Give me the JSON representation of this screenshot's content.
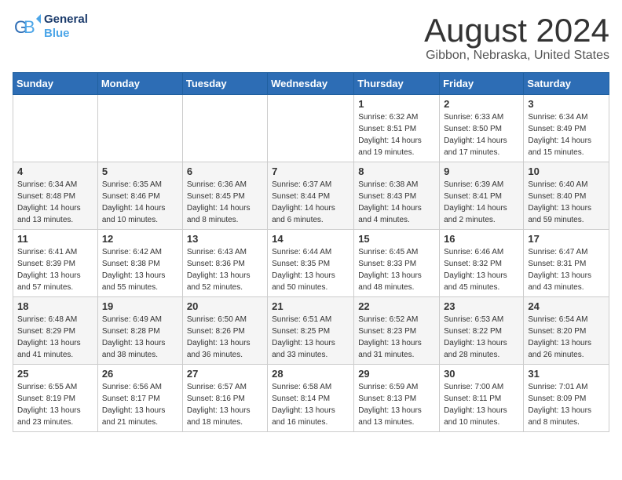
{
  "header": {
    "logo_line1": "General",
    "logo_line2": "Blue",
    "month_title": "August 2024",
    "location": "Gibbon, Nebraska, United States"
  },
  "weekdays": [
    "Sunday",
    "Monday",
    "Tuesday",
    "Wednesday",
    "Thursday",
    "Friday",
    "Saturday"
  ],
  "weeks": [
    [
      {
        "day": "",
        "info": ""
      },
      {
        "day": "",
        "info": ""
      },
      {
        "day": "",
        "info": ""
      },
      {
        "day": "",
        "info": ""
      },
      {
        "day": "1",
        "info": "Sunrise: 6:32 AM\nSunset: 8:51 PM\nDaylight: 14 hours\nand 19 minutes."
      },
      {
        "day": "2",
        "info": "Sunrise: 6:33 AM\nSunset: 8:50 PM\nDaylight: 14 hours\nand 17 minutes."
      },
      {
        "day": "3",
        "info": "Sunrise: 6:34 AM\nSunset: 8:49 PM\nDaylight: 14 hours\nand 15 minutes."
      }
    ],
    [
      {
        "day": "4",
        "info": "Sunrise: 6:34 AM\nSunset: 8:48 PM\nDaylight: 14 hours\nand 13 minutes."
      },
      {
        "day": "5",
        "info": "Sunrise: 6:35 AM\nSunset: 8:46 PM\nDaylight: 14 hours\nand 10 minutes."
      },
      {
        "day": "6",
        "info": "Sunrise: 6:36 AM\nSunset: 8:45 PM\nDaylight: 14 hours\nand 8 minutes."
      },
      {
        "day": "7",
        "info": "Sunrise: 6:37 AM\nSunset: 8:44 PM\nDaylight: 14 hours\nand 6 minutes."
      },
      {
        "day": "8",
        "info": "Sunrise: 6:38 AM\nSunset: 8:43 PM\nDaylight: 14 hours\nand 4 minutes."
      },
      {
        "day": "9",
        "info": "Sunrise: 6:39 AM\nSunset: 8:41 PM\nDaylight: 14 hours\nand 2 minutes."
      },
      {
        "day": "10",
        "info": "Sunrise: 6:40 AM\nSunset: 8:40 PM\nDaylight: 13 hours\nand 59 minutes."
      }
    ],
    [
      {
        "day": "11",
        "info": "Sunrise: 6:41 AM\nSunset: 8:39 PM\nDaylight: 13 hours\nand 57 minutes."
      },
      {
        "day": "12",
        "info": "Sunrise: 6:42 AM\nSunset: 8:38 PM\nDaylight: 13 hours\nand 55 minutes."
      },
      {
        "day": "13",
        "info": "Sunrise: 6:43 AM\nSunset: 8:36 PM\nDaylight: 13 hours\nand 52 minutes."
      },
      {
        "day": "14",
        "info": "Sunrise: 6:44 AM\nSunset: 8:35 PM\nDaylight: 13 hours\nand 50 minutes."
      },
      {
        "day": "15",
        "info": "Sunrise: 6:45 AM\nSunset: 8:33 PM\nDaylight: 13 hours\nand 48 minutes."
      },
      {
        "day": "16",
        "info": "Sunrise: 6:46 AM\nSunset: 8:32 PM\nDaylight: 13 hours\nand 45 minutes."
      },
      {
        "day": "17",
        "info": "Sunrise: 6:47 AM\nSunset: 8:31 PM\nDaylight: 13 hours\nand 43 minutes."
      }
    ],
    [
      {
        "day": "18",
        "info": "Sunrise: 6:48 AM\nSunset: 8:29 PM\nDaylight: 13 hours\nand 41 minutes."
      },
      {
        "day": "19",
        "info": "Sunrise: 6:49 AM\nSunset: 8:28 PM\nDaylight: 13 hours\nand 38 minutes."
      },
      {
        "day": "20",
        "info": "Sunrise: 6:50 AM\nSunset: 8:26 PM\nDaylight: 13 hours\nand 36 minutes."
      },
      {
        "day": "21",
        "info": "Sunrise: 6:51 AM\nSunset: 8:25 PM\nDaylight: 13 hours\nand 33 minutes."
      },
      {
        "day": "22",
        "info": "Sunrise: 6:52 AM\nSunset: 8:23 PM\nDaylight: 13 hours\nand 31 minutes."
      },
      {
        "day": "23",
        "info": "Sunrise: 6:53 AM\nSunset: 8:22 PM\nDaylight: 13 hours\nand 28 minutes."
      },
      {
        "day": "24",
        "info": "Sunrise: 6:54 AM\nSunset: 8:20 PM\nDaylight: 13 hours\nand 26 minutes."
      }
    ],
    [
      {
        "day": "25",
        "info": "Sunrise: 6:55 AM\nSunset: 8:19 PM\nDaylight: 13 hours\nand 23 minutes."
      },
      {
        "day": "26",
        "info": "Sunrise: 6:56 AM\nSunset: 8:17 PM\nDaylight: 13 hours\nand 21 minutes."
      },
      {
        "day": "27",
        "info": "Sunrise: 6:57 AM\nSunset: 8:16 PM\nDaylight: 13 hours\nand 18 minutes."
      },
      {
        "day": "28",
        "info": "Sunrise: 6:58 AM\nSunset: 8:14 PM\nDaylight: 13 hours\nand 16 minutes."
      },
      {
        "day": "29",
        "info": "Sunrise: 6:59 AM\nSunset: 8:13 PM\nDaylight: 13 hours\nand 13 minutes."
      },
      {
        "day": "30",
        "info": "Sunrise: 7:00 AM\nSunset: 8:11 PM\nDaylight: 13 hours\nand 10 minutes."
      },
      {
        "day": "31",
        "info": "Sunrise: 7:01 AM\nSunset: 8:09 PM\nDaylight: 13 hours\nand 8 minutes."
      }
    ]
  ]
}
